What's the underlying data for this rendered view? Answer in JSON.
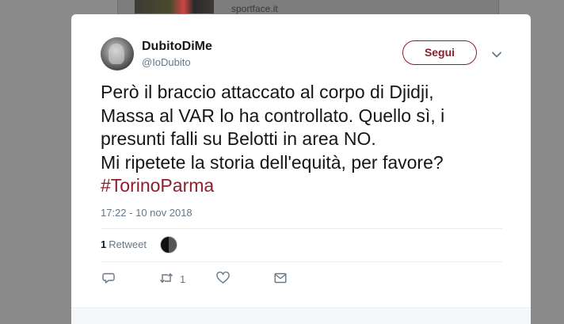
{
  "background": {
    "source_label": "sportface.it"
  },
  "tweet": {
    "user": {
      "display_name": "DubitoDiMe",
      "handle": "@IoDubito"
    },
    "follow_label": "Segui",
    "text_lines": [
      "Però il braccio attaccato al corpo di Djidji,",
      "Massa al VAR lo ha controllato. Quello sì, i",
      "presunti falli su Belotti in area NO.",
      "Mi ripetete la storia dell'equità, per favore?"
    ],
    "hashtag": "#TorinoParma",
    "timestamp": "17:22 - 10 nov 2018",
    "retweet_count": "1",
    "retweet_label": "Retweet",
    "actions": {
      "retweet_count": "1"
    }
  },
  "colors": {
    "accent": "#8b1f2b",
    "muted_text": "#657786",
    "overlay": "#8a8a8a"
  }
}
